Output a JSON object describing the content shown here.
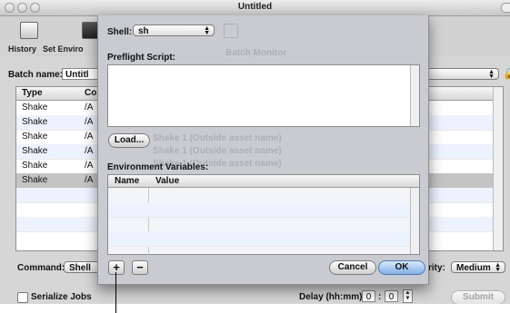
{
  "window": {
    "title": "Untitled"
  },
  "toolbar": {
    "history_label": "History",
    "set_environment_label": "Set Enviro"
  },
  "batch": {
    "name_label": "Batch name:",
    "name_value": "Untitl",
    "columns": [
      "Type",
      "Co"
    ],
    "rows": [
      {
        "type": "Shake",
        "cmd": "/A"
      },
      {
        "type": "Shake",
        "cmd": "/A"
      },
      {
        "type": "Shake",
        "cmd": "/A"
      },
      {
        "type": "Shake",
        "cmd": "/A"
      },
      {
        "type": "Shake",
        "cmd": "/A"
      },
      {
        "type": "Shake",
        "cmd": "/A"
      }
    ]
  },
  "bottom": {
    "command_label": "Command:",
    "command_value": "Shell",
    "priority_label": "rity:",
    "priority_value": "Medium",
    "serialize_label": "Serialize Jobs",
    "delay_label": "Delay (hh:mm):",
    "delay_hours": "0",
    "delay_separator": ":",
    "delay_minutes": "0",
    "submit_label": "Submit"
  },
  "sheet": {
    "shell_label": "Shell:",
    "shell_value": "sh",
    "preflight_label": "Preflight Script:",
    "load_label": "Load...",
    "env_label": "Environment Variables:",
    "env_columns": [
      "Name",
      "Value"
    ],
    "add_label": "+",
    "remove_label": "−",
    "cancel_label": "Cancel",
    "ok_label": "OK"
  }
}
